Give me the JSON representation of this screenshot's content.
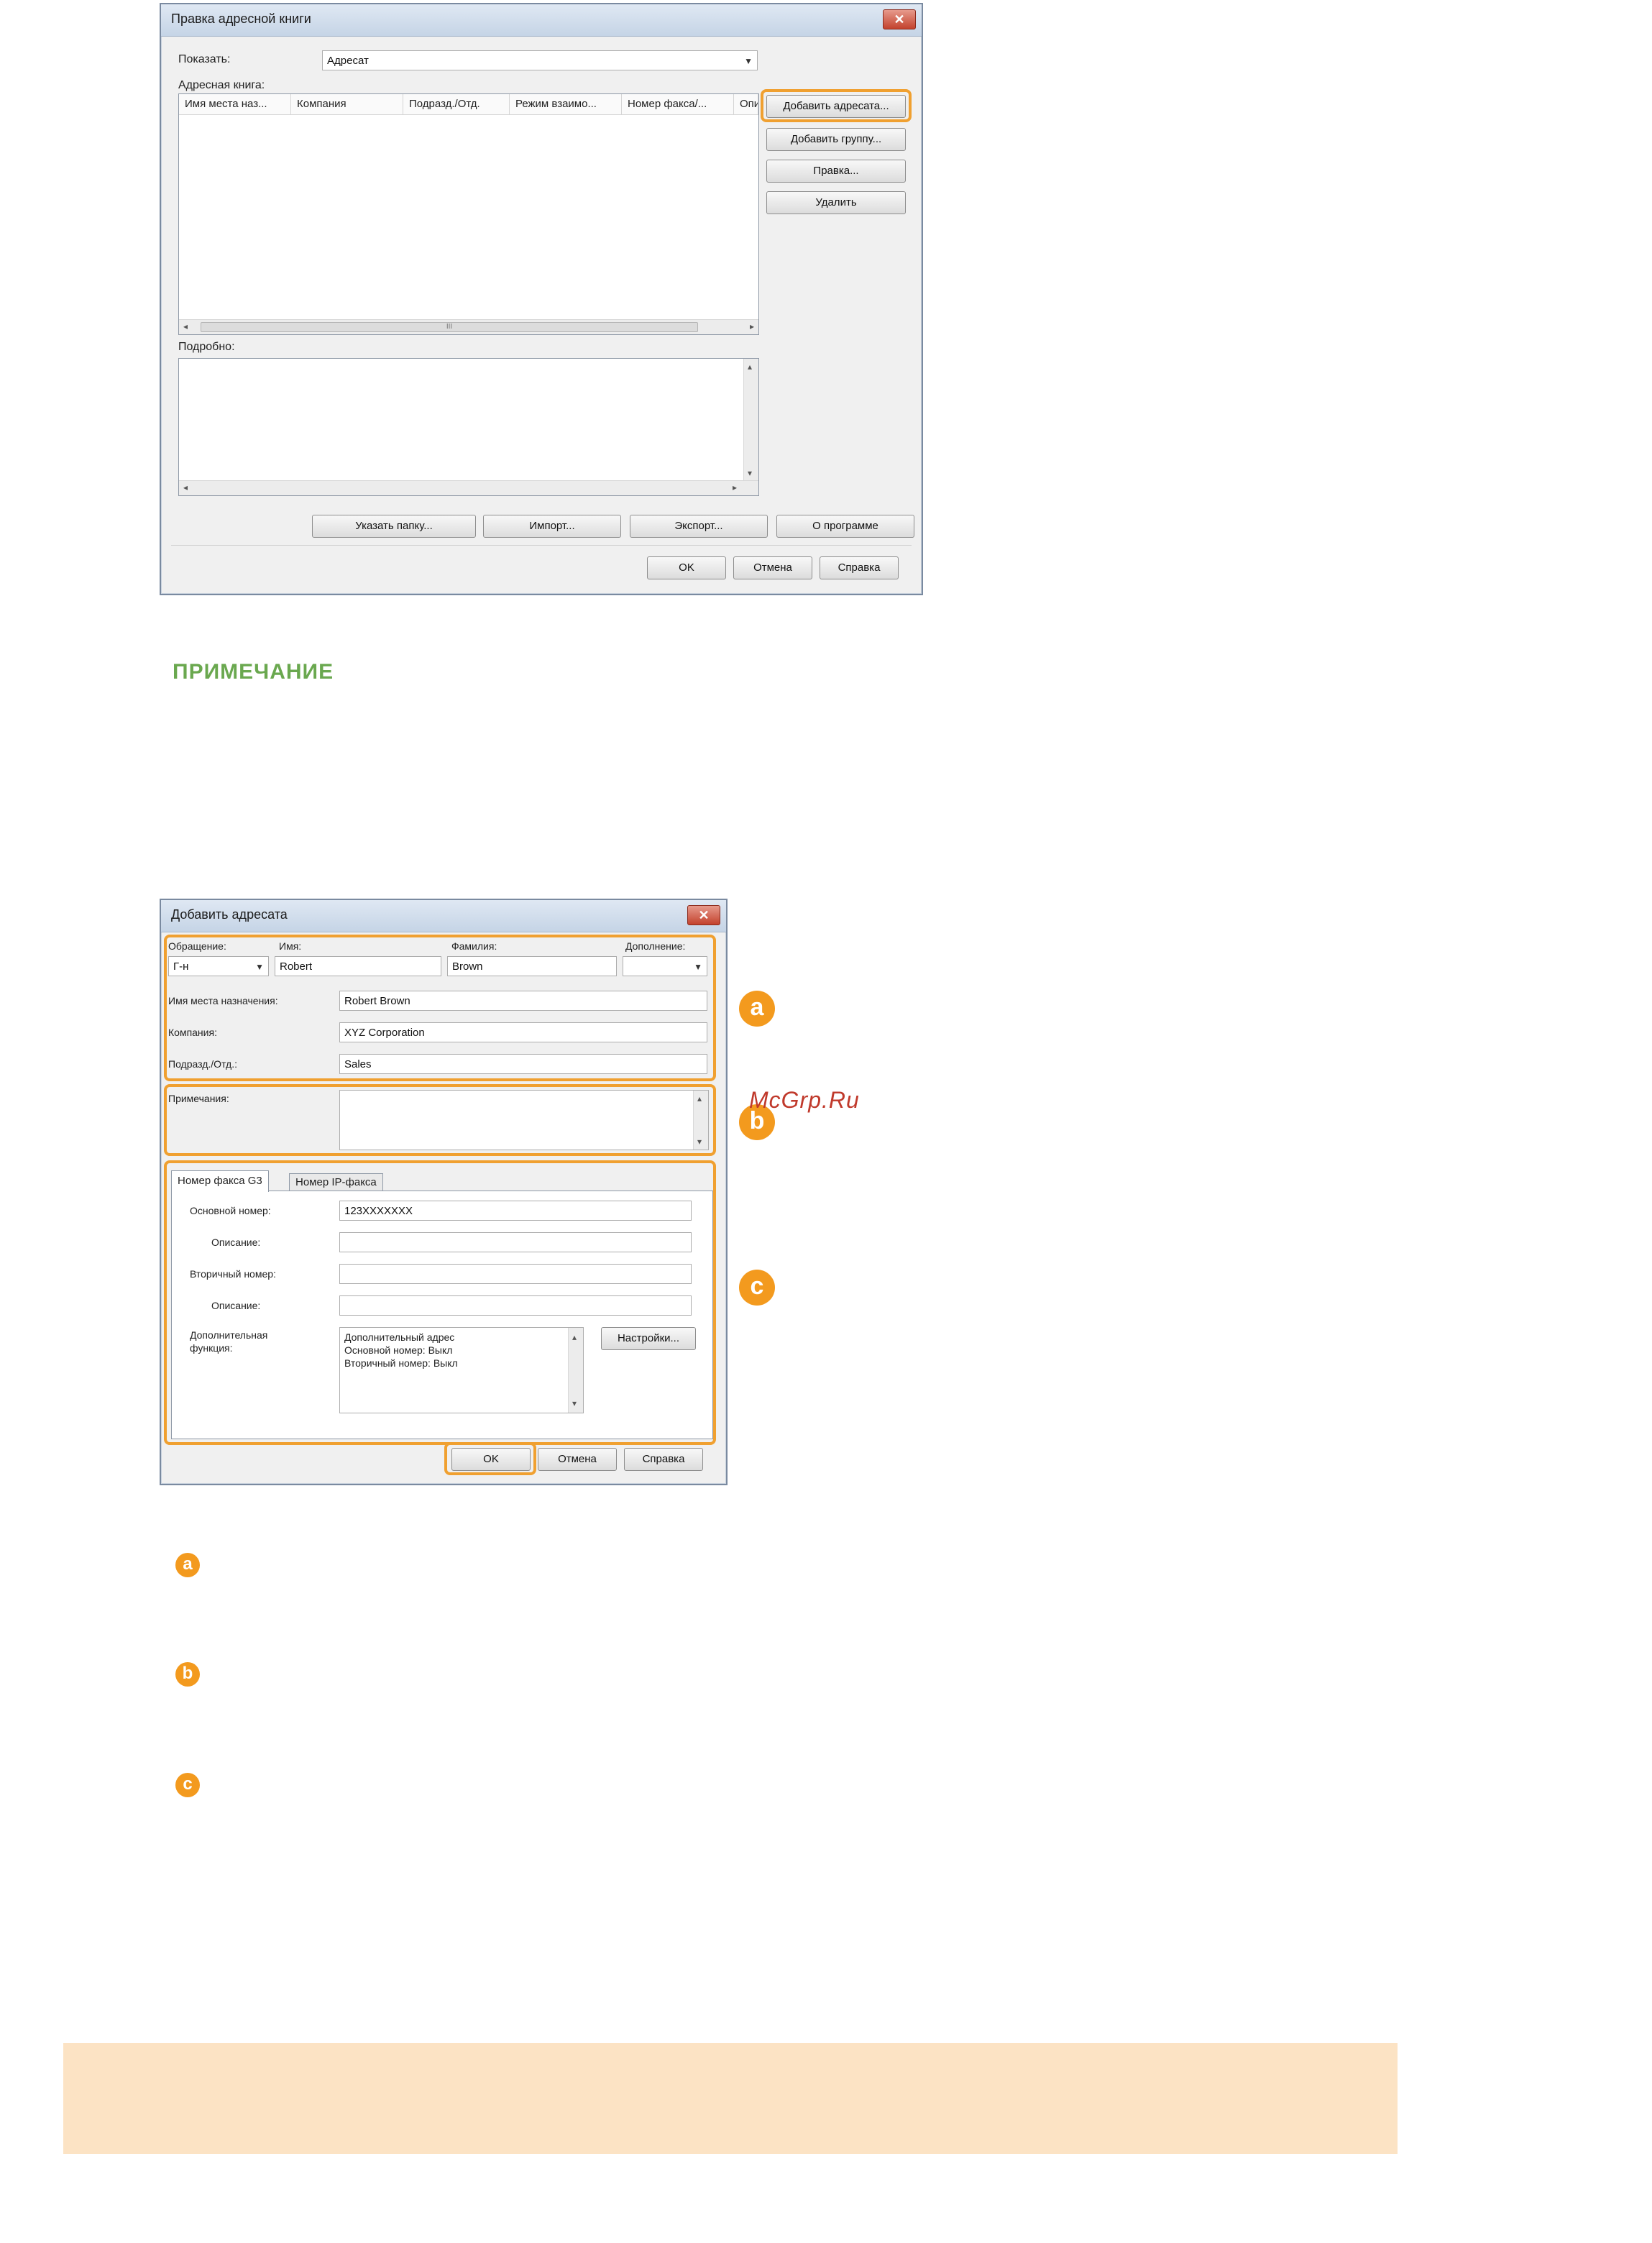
{
  "dialog1": {
    "title": "Правка адресной книги",
    "close": "✕",
    "show_label": "Показать:",
    "show_value": "Адресат",
    "addressbook_label": "Адресная книга:",
    "columns": [
      "Имя места наз...",
      "Компания",
      "Подразд./Отд.",
      "Режим взаимо...",
      "Номер факса/...",
      "Опи"
    ],
    "hscroll_mark": "III",
    "side_buttons": {
      "add_recipient": "Добавить адресата...",
      "add_group": "Добавить группу...",
      "edit": "Правка...",
      "delete": "Удалить"
    },
    "details_label": "Подробно:",
    "bottom_buttons": {
      "folder": "Указать папку...",
      "import": "Импорт...",
      "export": "Экспорт...",
      "about": "О программе"
    },
    "ok": "OK",
    "cancel": "Отмена",
    "help": "Справка"
  },
  "note_heading": "ПРИМЕЧАНИЕ",
  "dialog2": {
    "title": "Добавить адресата",
    "close": "✕",
    "labels": {
      "salutation": "Обращение:",
      "first_name": "Имя:",
      "last_name": "Фамилия:",
      "suffix": "Дополнение:",
      "dest_name": "Имя места назначения:",
      "company": "Компания:",
      "dept": "Подразд./Отд.:",
      "notes": "Примечания:",
      "main_number": "Основной номер:",
      "desc1": "Описание:",
      "secondary_number": "Вторичный номер:",
      "desc2": "Описание:",
      "extra_function": "Дополнительная функция:"
    },
    "values": {
      "salutation": "Г-н",
      "first_name": "Robert",
      "last_name": "Brown",
      "suffix": "",
      "dest_name": "Robert Brown",
      "company": "XYZ Corporation",
      "dept": "Sales",
      "main_number": "123XXXXXXX"
    },
    "tabs": [
      "Номер факса G3",
      "Номер IP-факса"
    ],
    "extra_text": [
      "Дополнительный адрес",
      "Основной номер:  Выкл",
      "Вторичный номер: Выкл"
    ],
    "settings": "Настройки...",
    "ok": "OK",
    "cancel": "Отмена",
    "help": "Справка"
  },
  "callouts": [
    "a",
    "b",
    "c"
  ],
  "watermark": "McGrp.Ru",
  "colors": {
    "accent_orange": "#f39a1e",
    "note_green": "#6aa84f",
    "bottom_band": "#fce3c4"
  }
}
